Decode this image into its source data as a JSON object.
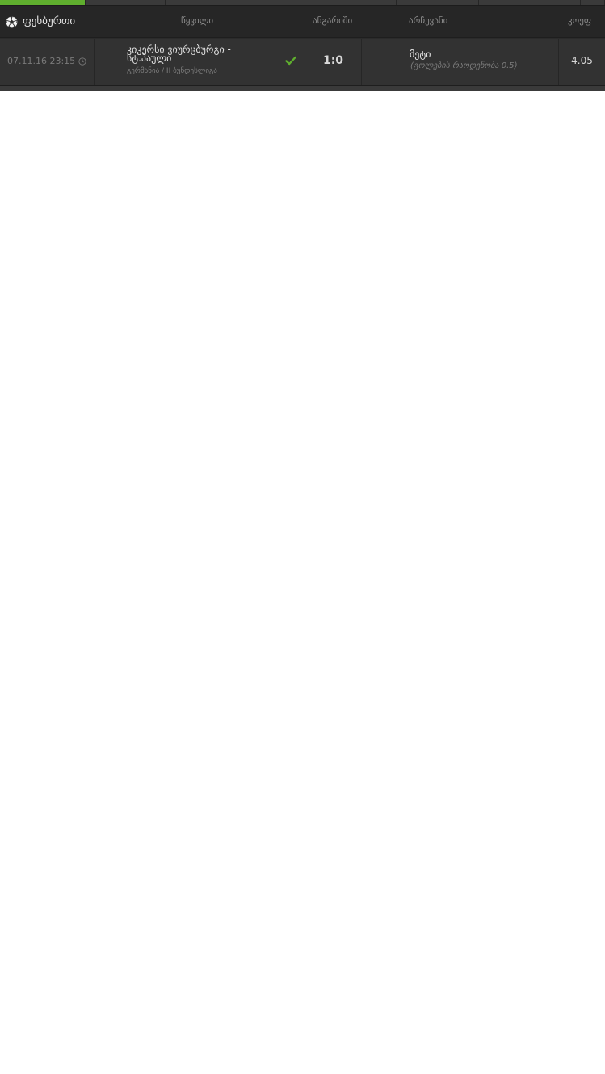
{
  "colors": {
    "accent": "#5fae2e",
    "header_bg": "#262626",
    "row_bg": "#323232",
    "text_muted": "#8c8c8c",
    "text_main": "#e2e2e2"
  },
  "header": {
    "sport_icon": "soccer-ball-icon",
    "sport_label": "ფეხბურთი",
    "col_event": "წყვილი",
    "col_score": "ანგარიში",
    "col_choice": "არჩევანი",
    "col_odds": "კოეფ"
  },
  "bet": {
    "datetime": "07.11.16 23:15",
    "clock_icon": "clock-icon",
    "event": "კიკერსი ვიურცბურგი - სტ.პაული",
    "league": "გერმანია / II ბუნდესლიგა",
    "status_icon": "checkmark-icon",
    "score": "1:0",
    "choice": "მეტი",
    "choice_detail": "(გოლების რაოდენობა 0.5)",
    "odds": "4.05"
  }
}
